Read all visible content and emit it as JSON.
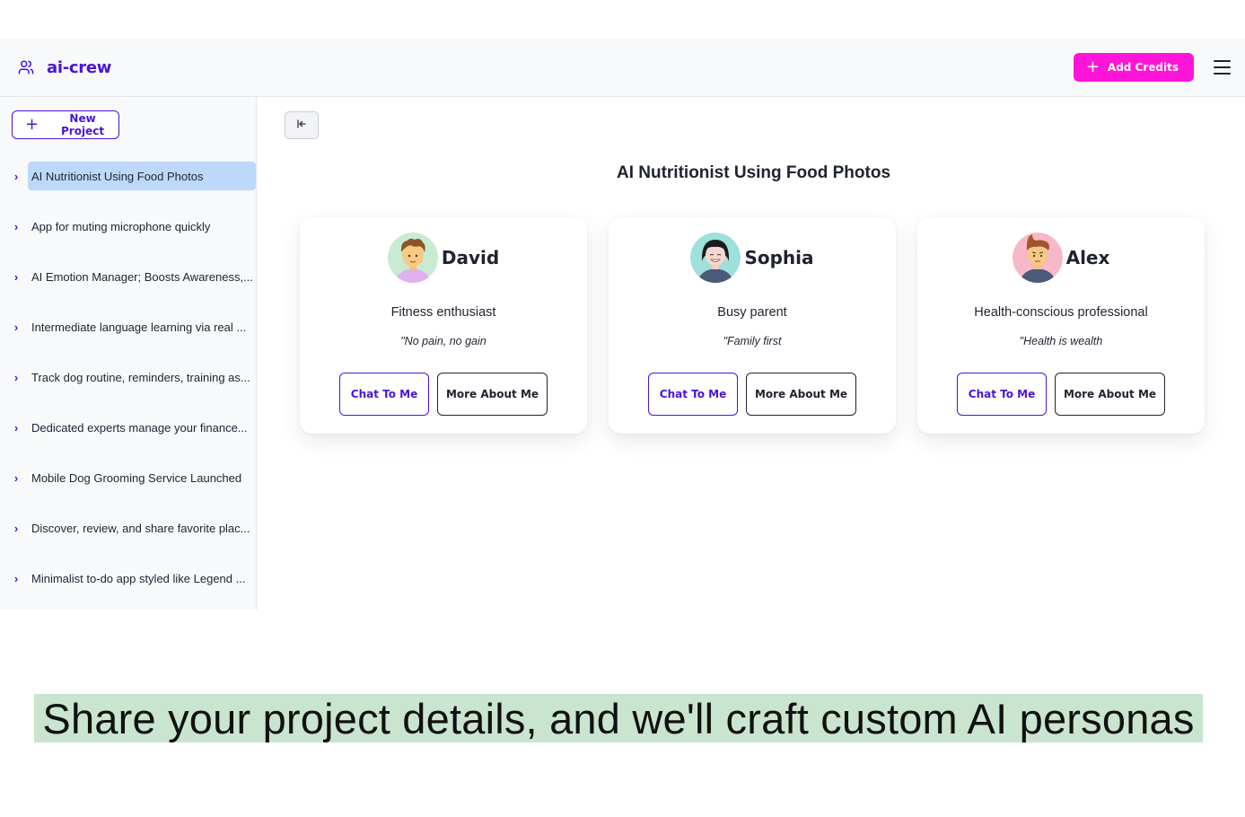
{
  "app": {
    "name": "ai-crew",
    "logo_icon": "users-icon"
  },
  "header": {
    "add_credits_label": "Add Credits",
    "menu_icon": "hamburger-menu-icon"
  },
  "sidebar": {
    "new_project_label": "New Project",
    "projects": [
      {
        "label": "AI Nutritionist Using Food Photos",
        "active": true
      },
      {
        "label": "App for muting microphone quickly"
      },
      {
        "label": "AI Emotion Manager; Boosts Awareness,..."
      },
      {
        "label": "Intermediate language learning via real ..."
      },
      {
        "label": "Track dog routine, reminders, training as..."
      },
      {
        "label": "Dedicated experts manage your finance..."
      },
      {
        "label": "Mobile Dog Grooming Service Launched"
      },
      {
        "label": "Discover, review, and share favorite plac..."
      },
      {
        "label": "Minimalist to-do app styled like Legend ..."
      }
    ]
  },
  "main": {
    "collapse_icon": "collapse-left-icon",
    "title": "AI Nutritionist Using Food Photos",
    "personas": [
      {
        "name": "David",
        "role": "Fitness enthusiast",
        "quote": "\"No pain, no gain",
        "chat_label": "Chat To Me",
        "more_label": "More About Me",
        "avatar_bg": "#c8ebd2"
      },
      {
        "name": "Sophia",
        "role": "Busy parent",
        "quote": "\"Family first",
        "chat_label": "Chat To Me",
        "more_label": "More About Me",
        "avatar_bg": "#9fe0dc"
      },
      {
        "name": "Alex",
        "role": "Health-conscious professional",
        "quote": "\"Health is wealth",
        "chat_label": "Chat To Me",
        "more_label": "More About Me",
        "avatar_bg": "#f7b8c9"
      }
    ]
  },
  "caption": "Share your project details, and we'll craft custom AI personas",
  "colors": {
    "brand": "#4a14d6",
    "accent": "#ff15d9",
    "active_item": "#bcd9fb",
    "caption_bg": "#c9e5cf"
  }
}
